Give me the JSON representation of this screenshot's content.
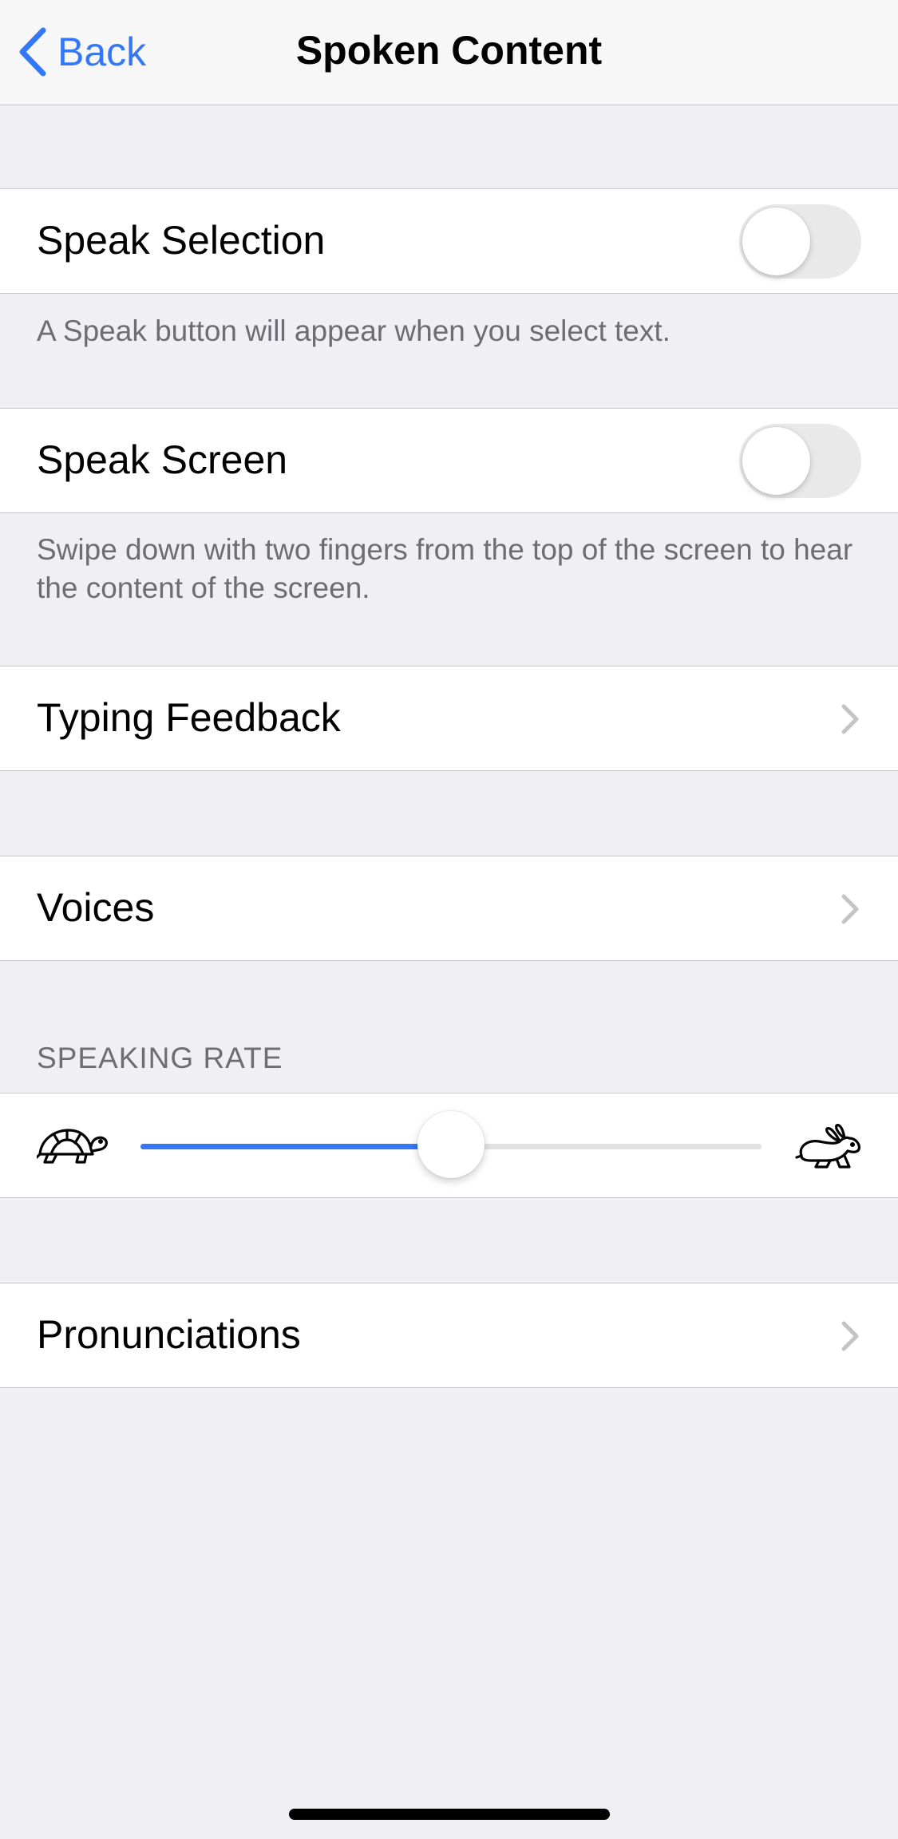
{
  "nav": {
    "back_label": "Back",
    "title": "Spoken Content"
  },
  "speak_selection": {
    "label": "Speak Selection",
    "enabled": false,
    "footer": "A Speak button will appear when you select text."
  },
  "speak_screen": {
    "label": "Speak Screen",
    "enabled": false,
    "footer": "Swipe down with two fingers from the top of the screen to hear the content of the screen."
  },
  "typing_feedback": {
    "label": "Typing Feedback"
  },
  "voices": {
    "label": "Voices"
  },
  "speaking_rate": {
    "header": "SPEAKING RATE",
    "value": 0.5,
    "min_icon": "turtle-icon",
    "max_icon": "rabbit-icon"
  },
  "pronunciations": {
    "label": "Pronunciations"
  },
  "colors": {
    "accent": "#3478f6",
    "background": "#efeff4",
    "toggle_off": "#e9e9ea"
  }
}
